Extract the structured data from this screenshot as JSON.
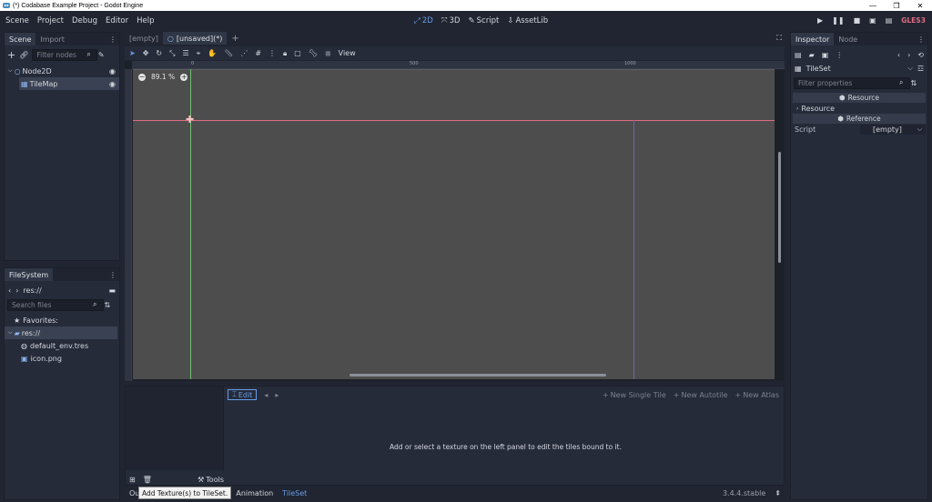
{
  "window": {
    "title": "(*) Codabase Example Project - Godot Engine"
  },
  "menu": {
    "items": [
      "Scene",
      "Project",
      "Debug",
      "Editor",
      "Help"
    ]
  },
  "workspaces": {
    "two_d": "2D",
    "three_d": "3D",
    "script": "Script",
    "assetlib": "AssetLib"
  },
  "renderer": {
    "label": "GLES3"
  },
  "scene_dock": {
    "tabs": [
      "Scene",
      "Import"
    ],
    "filter_placeholder": "Filter nodes",
    "tree": [
      {
        "label": "Node2D"
      },
      {
        "label": "TileMap"
      }
    ]
  },
  "filesystem_dock": {
    "tab": "FileSystem",
    "path": "res://",
    "search_placeholder": "Search files",
    "items": [
      {
        "label": "Favorites:"
      },
      {
        "label": "res://"
      },
      {
        "label": "default_env.tres"
      },
      {
        "label": "icon.png"
      }
    ]
  },
  "editor_tabs": {
    "tabs": [
      "[empty]",
      "[unsaved](*)"
    ],
    "add": "+"
  },
  "toolbar": {
    "view_label": "View"
  },
  "viewport": {
    "zoom": "89.1 %",
    "ruler_top": [
      "0",
      "500",
      "1000"
    ],
    "accent": "#e06b84"
  },
  "tileset_editor": {
    "edit_label": "Edit",
    "new_single_tile": "New Single Tile",
    "new_autotile": "New Autotile",
    "new_atlas": "New Atlas",
    "message": "Add or select a texture on the left panel to edit the tiles bound to it.",
    "tools_label": "Tools",
    "tooltip": "Add Texture(s) to TileSet."
  },
  "bottom_bar": {
    "tabs": [
      "Ou",
      "Animation",
      "TileSet"
    ],
    "version": "3.4.4.stable"
  },
  "inspector": {
    "tabs": [
      "Inspector",
      "Node"
    ],
    "resource_name": "TileSet",
    "filter_placeholder": "Filter properties",
    "sections": {
      "resource_header": "Resource",
      "resource_group": "Resource",
      "reference_header": "Reference"
    },
    "script_label": "Script",
    "script_value": "[empty]"
  },
  "colors": {
    "accent": "#699ce8",
    "active_tile_text": "#699ce8"
  }
}
